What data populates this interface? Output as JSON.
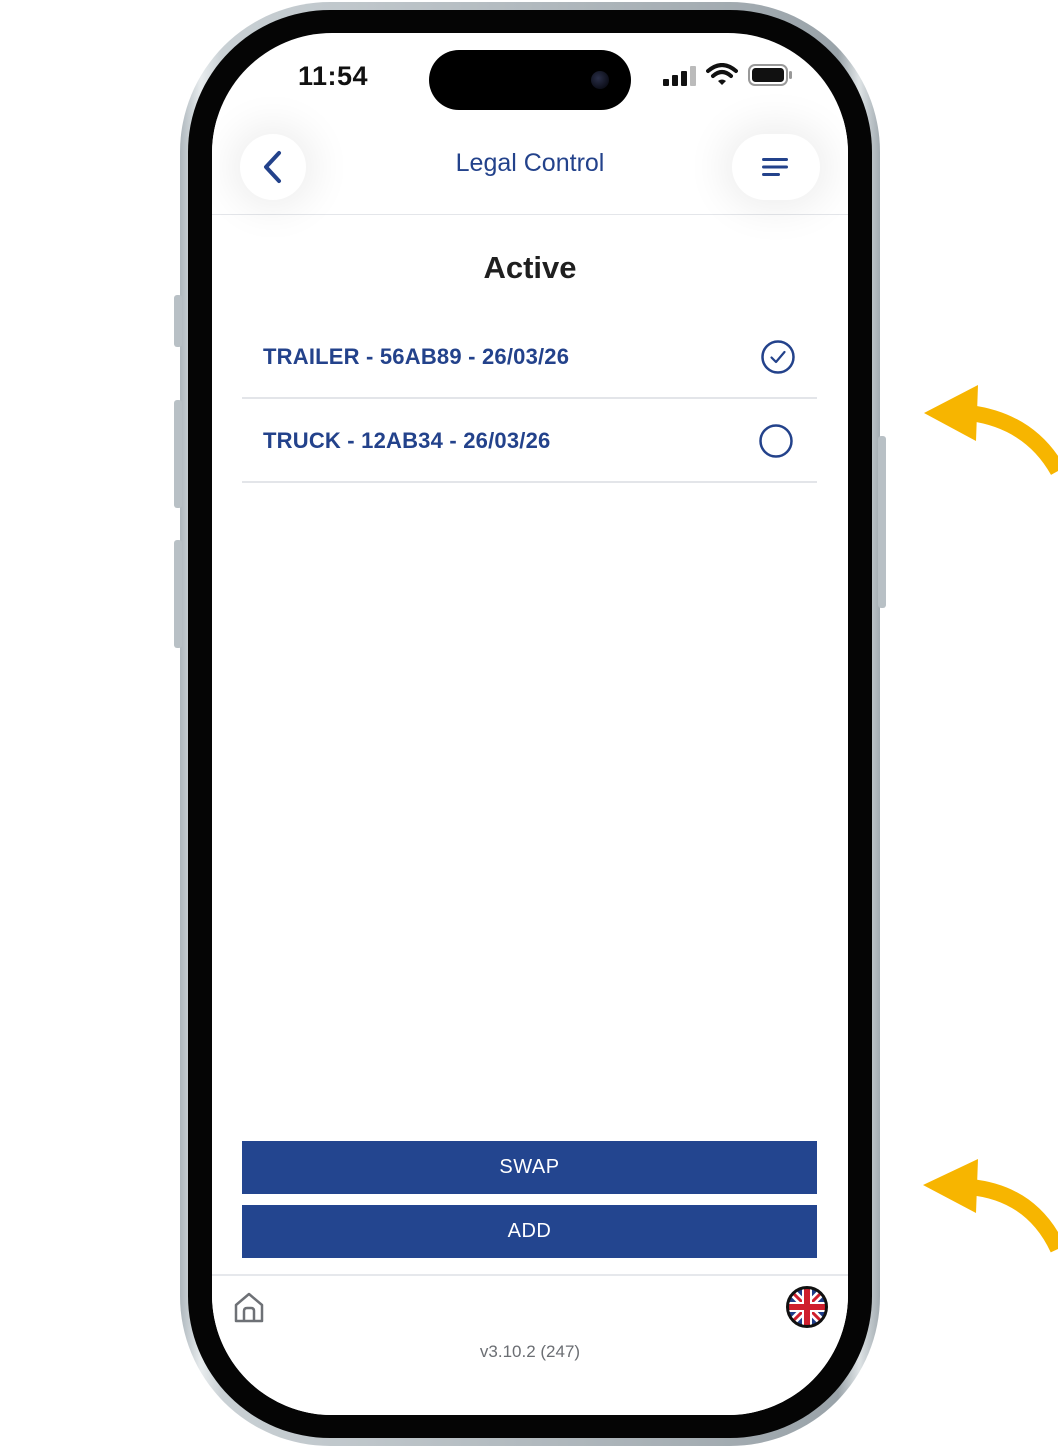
{
  "status_bar": {
    "time": "11:54"
  },
  "header": {
    "title": "Legal Control"
  },
  "section": {
    "title": "Active"
  },
  "list": [
    {
      "label": "TRAILER - 56AB89 - 26/03/26",
      "selected": true
    },
    {
      "label": "TRUCK - 12AB34 - 26/03/26",
      "selected": false
    }
  ],
  "actions": {
    "swap_label": "SWAP",
    "add_label": "ADD"
  },
  "footer": {
    "version": "v3.10.2 (247)"
  },
  "icons": {
    "back": "chevron-left-icon",
    "menu": "hamburger-menu-icon",
    "home": "home-icon",
    "language": "uk-flag-icon",
    "selected": "check-circle-icon",
    "unselected": "empty-circle-icon"
  },
  "colors": {
    "brand_blue": "#23428b",
    "button_blue": "#23458f",
    "annotation_arrow": "#f7b500"
  }
}
